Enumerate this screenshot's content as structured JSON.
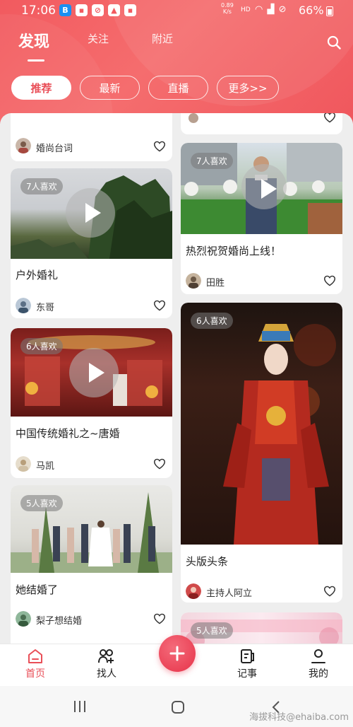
{
  "statusbar": {
    "time": "17:06",
    "speed_value": "0.89",
    "speed_unit": "K/s",
    "hd": "HD",
    "battery": "66%"
  },
  "tabs": [
    {
      "label": "发现",
      "active": true
    },
    {
      "label": "关注",
      "active": false
    },
    {
      "label": "附近",
      "active": false
    }
  ],
  "chips": [
    {
      "label": "推荐",
      "active": true
    },
    {
      "label": "最新",
      "active": false
    },
    {
      "label": "直播",
      "active": false
    },
    {
      "label": "更多>>",
      "active": false
    }
  ],
  "feed": {
    "left": [
      {
        "title": "",
        "likes": "",
        "author": "婚尚台词"
      },
      {
        "title": "户外婚礼",
        "likes": "7人喜欢",
        "author": "东哥"
      },
      {
        "title": "中国传统婚礼之~唐婚",
        "likes": "6人喜欢",
        "author": "马凯"
      },
      {
        "title": "她结婚了",
        "likes": "5人喜欢",
        "author": "梨子想结婚"
      }
    ],
    "right": [
      {
        "title": "热烈祝贺婚尚上线！",
        "likes": "7人喜欢",
        "author": "田胜"
      },
      {
        "title": "头版头条",
        "likes": "6人喜欢",
        "author": "主持人阿立"
      },
      {
        "title": "",
        "likes": "5人喜欢",
        "author": ""
      }
    ]
  },
  "bottomnav": [
    {
      "label": "首页",
      "icon": "home-icon",
      "active": true
    },
    {
      "label": "找人",
      "icon": "find-people-icon",
      "active": false
    },
    {
      "label": "记事",
      "icon": "notes-icon",
      "active": false
    },
    {
      "label": "我的",
      "icon": "profile-icon",
      "active": false
    }
  ],
  "fab_icon": "plus-icon",
  "watermark": "海拔科技@ehaiba.com",
  "colors": {
    "accent": "#e94f58",
    "header": "#f25a5f"
  }
}
